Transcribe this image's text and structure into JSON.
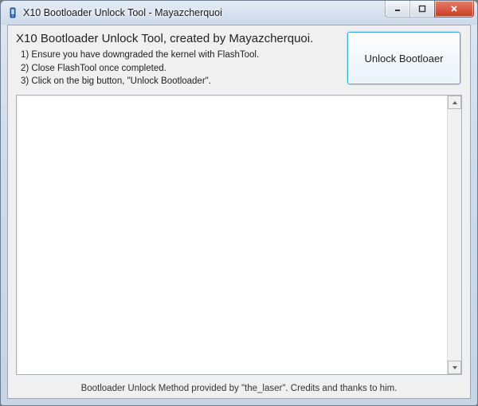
{
  "window": {
    "title": "X10 Bootloader Unlock Tool - Mayazcherquoi"
  },
  "header": {
    "heading": "X10 Bootloader Unlock Tool, created by Mayazcherquoi.",
    "steps": [
      "1) Ensure you have downgraded the kernel with FlashTool.",
      "2) Close FlashTool once completed.",
      "3) Click on the big button, \"Unlock Bootloader\"."
    ]
  },
  "unlock_button": {
    "label": "Unlock Bootloaer"
  },
  "log": {
    "content": ""
  },
  "footer": {
    "credits": "Bootloader Unlock Method provided by \"the_laser\". Credits and thanks to him."
  },
  "icons": {
    "app": "phone-icon",
    "minimize": "minimize-icon",
    "maximize": "maximize-icon",
    "close": "close-icon",
    "scroll_up": "chevron-up-icon",
    "scroll_down": "chevron-down-icon"
  }
}
